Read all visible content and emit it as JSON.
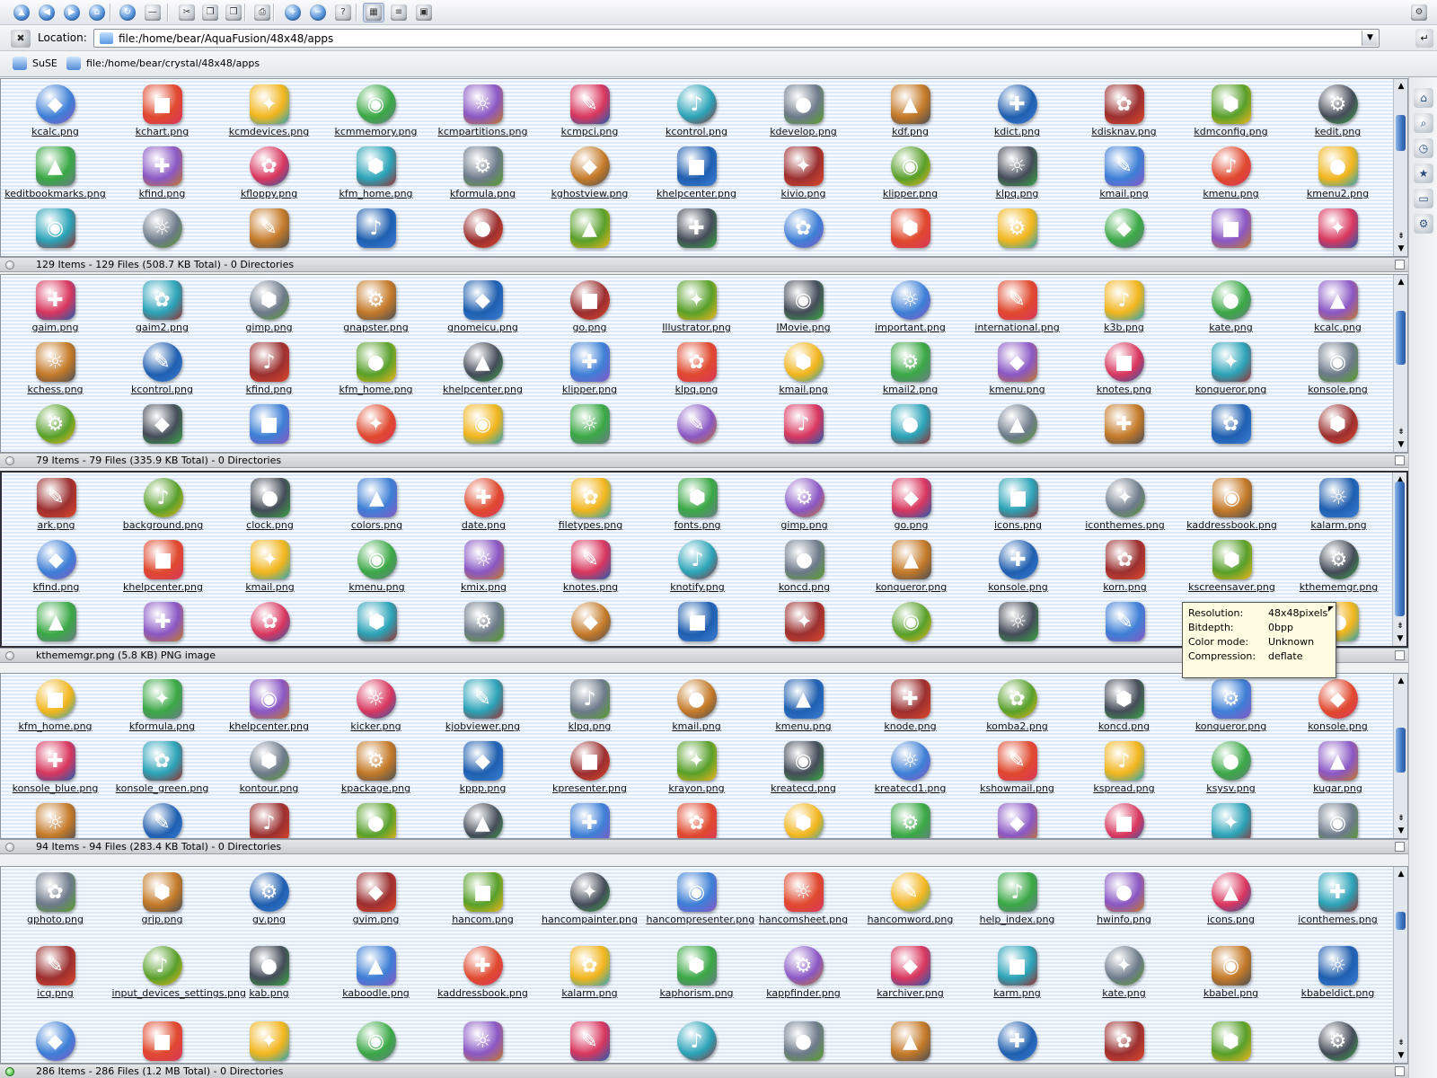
{
  "toolbar": {
    "buttons": [
      {
        "name": "up",
        "glyph": "▲"
      },
      {
        "name": "back",
        "glyph": "◀"
      },
      {
        "name": "forward",
        "glyph": "▶"
      },
      {
        "name": "home",
        "glyph": "⌂"
      },
      {
        "name": "reload",
        "glyph": "↻"
      },
      {
        "name": "stop",
        "glyph": "—"
      },
      {
        "name": "cut",
        "glyph": "✂"
      },
      {
        "name": "copy",
        "glyph": "❐"
      },
      {
        "name": "paste",
        "glyph": "❒"
      },
      {
        "name": "print",
        "glyph": "⎙"
      },
      {
        "name": "zoom-in",
        "glyph": "+"
      },
      {
        "name": "zoom-out",
        "glyph": "−"
      },
      {
        "name": "security",
        "glyph": "?"
      },
      {
        "name": "icon-view",
        "glyph": "▦"
      },
      {
        "name": "detail-view",
        "glyph": "≡"
      },
      {
        "name": "view-profile",
        "glyph": "▣"
      }
    ],
    "throbber_glyph": "⚙"
  },
  "location": {
    "clear_glyph": "✖",
    "label": "Location:",
    "url": "file:/home/bear/AquaFusion/48x48/apps",
    "dropdown_glyph": "▼",
    "go_glyph": "↵"
  },
  "bookmarks": [
    {
      "label": "SuSE"
    },
    {
      "label": "file:/home/bear/crystal/48x48/apps"
    }
  ],
  "views": [
    {
      "status": "129 Items - 129 Files (508.7 KB Total) - 0 Directories",
      "rows": [
        [
          "kcalc.png",
          "kchart.png",
          "kcmdevices.png",
          "kcmmemory.png",
          "kcmpartitions.png",
          "kcmpci.png",
          "kcontrol.png",
          "kdevelop.png",
          "kdf.png",
          "kdict.png",
          "kdisknav.png",
          "kdmconfig.png",
          "kedit.png"
        ],
        [
          "keditbookmarks.png",
          "kfind.png",
          "kfloppy.png",
          "kfm_home.png",
          "kformula.png",
          "kghostview.png",
          "khelpcenter.png",
          "kivio.png",
          "klipper.png",
          "klpq.png",
          "kmail.png",
          "kmenu.png",
          "kmenu2.png"
        ],
        [
          "",
          "",
          "",
          "",
          "",
          "",
          "",
          "",
          "",
          "",
          "",
          "",
          ""
        ]
      ]
    },
    {
      "status": "79 Items - 79 Files (335.9 KB Total) - 0 Directories",
      "rows": [
        [
          "gaim.png",
          "gaim2.png",
          "gimp.png",
          "gnapster.png",
          "gnomeicu.png",
          "go.png",
          "Illustrator.png",
          "IMovie.png",
          "important.png",
          "international.png",
          "k3b.png",
          "kate.png",
          "kcalc.png"
        ],
        [
          "kchess.png",
          "kcontrol.png",
          "kfind.png",
          "kfm_home.png",
          "khelpcenter.png",
          "klipper.png",
          "klpq.png",
          "kmail.png",
          "kmail2.png",
          "kmenu.png",
          "knotes.png",
          "konqueror.png",
          "konsole.png"
        ],
        [
          "",
          "",
          "",
          "",
          "",
          "",
          "",
          "",
          "",
          "",
          "",
          "",
          ""
        ]
      ]
    },
    {
      "status": "kthememgr.png (5.8 KB)  PNG image",
      "rows": [
        [
          "ark.png",
          "background.png",
          "clock.png",
          "colors.png",
          "date.png",
          "filetypes.png",
          "fonts.png",
          "gimp.png",
          "go.png",
          "icons.png",
          "iconthemes.png",
          "kaddressbook.png",
          "kalarm.png"
        ],
        [
          "kfind.png",
          "khelpcenter.png",
          "kmail.png",
          "kmenu.png",
          "kmix.png",
          "knotes.png",
          "knotify.png",
          "koncd.png",
          "konqueror.png",
          "konsole.png",
          "korn.png",
          "kscreensaver.png",
          "kthememgr.png"
        ],
        [
          "",
          "",
          "",
          "",
          "",
          "",
          "",
          "",
          "",
          "",
          "",
          "",
          ""
        ]
      ]
    },
    {
      "status": "94 Items - 94 Files (283.4 KB Total) - 0 Directories",
      "rows": [
        [
          "kfm_home.png",
          "kformula.png",
          "khelpcenter.png",
          "kicker.png",
          "kjobviewer.png",
          "klpq.png",
          "kmail.png",
          "kmenu.png",
          "knode.png",
          "komba2.png",
          "koncd.png",
          "konqueror.png",
          "konsole.png"
        ],
        [
          "konsole_blue.png",
          "konsole_green.png",
          "kontour.png",
          "kpackage.png",
          "kppp.png",
          "kpresenter.png",
          "krayon.png",
          "kreatecd.png",
          "kreatecd1.png",
          "kshowmail.png",
          "kspread.png",
          "ksysv.png",
          "kugar.png"
        ],
        [
          "",
          "",
          "",
          "",
          "",
          "",
          "",
          "",
          "",
          "",
          "",
          "",
          ""
        ]
      ]
    },
    {
      "status": "286 Items - 286 Files (1.2 MB Total) - 0 Directories",
      "rows": [
        [
          "gphoto.png",
          "grip.png",
          "gv.png",
          "gvim.png",
          "hancom.png",
          "hancompainter.png",
          "hancompresenter.png",
          "hancomsheet.png",
          "hancomword.png",
          "help_index.png",
          "hwinfo.png",
          "icons.png",
          "iconthemes.png"
        ],
        [
          "icq.png",
          "input_devices_settings.png",
          "kab.png",
          "kaboodle.png",
          "kaddressbook.png",
          "kalarm.png",
          "kaphorism.png",
          "kappfinder.png",
          "karchiver.png",
          "karm.png",
          "kate.png",
          "kbabel.png",
          "kbabeldict.png"
        ],
        [
          "",
          "",
          "",
          "",
          "",
          "",
          "",
          "",
          "",
          "",
          "",
          "",
          ""
        ]
      ]
    }
  ],
  "tooltip": {
    "rows": [
      {
        "key": "Resolution:",
        "value": "48x48pixels"
      },
      {
        "key": "Bitdepth:",
        "value": "0bpp"
      },
      {
        "key": "Color mode:",
        "value": "Unknown"
      },
      {
        "key": "Compression:",
        "value": "deflate"
      }
    ]
  },
  "scroll_arrows": {
    "up": "▲",
    "down": "▼",
    "down2": "⇟"
  },
  "icon_palette": [
    "#3d7fd6",
    "#e0492e",
    "#f2b51c",
    "#3aa845",
    "#8a57c4",
    "#d9365e",
    "#2aa3b8",
    "#6d7a8a",
    "#c57a28",
    "#1f5fb0",
    "#9c2f2f",
    "#58a02a",
    "#444c58"
  ],
  "icon_glyphs": [
    "◆",
    "●",
    "■",
    "▲",
    "✦",
    "✚",
    "◉",
    "✿",
    "☼",
    "⬢",
    "✎",
    "⚙",
    "♪"
  ]
}
